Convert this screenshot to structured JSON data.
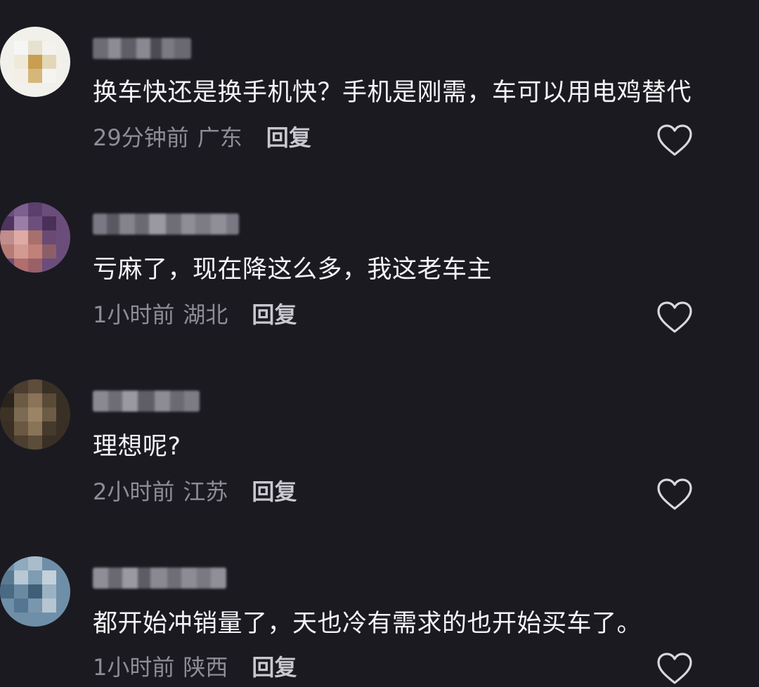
{
  "comments": [
    {
      "text": "换车快还是换手机快？手机是刚需，车可以用电鸡替代",
      "time": "29分钟前",
      "location": "广东",
      "reply_label": "回复",
      "avatar_colors": [
        "#f4f4f4",
        "#e0d9c7",
        "#c9a25a",
        "#f1efe8"
      ]
    },
    {
      "text": "亏麻了，现在降这么多，我这老车主",
      "time": "1小时前",
      "location": "湖北",
      "reply_label": "回复",
      "avatar_colors": [
        "#5a3c6e",
        "#8a6b9a",
        "#d9a7a2",
        "#b0706a"
      ]
    },
    {
      "text": "理想呢?",
      "time": "2小时前",
      "location": "江苏",
      "reply_label": "回复",
      "avatar_colors": [
        "#3b2e22",
        "#6d5a44",
        "#8a7458",
        "#2a241d"
      ]
    },
    {
      "text": "都开始冲销量了，天也冷有需求的也开始买车了。",
      "time": "1小时前",
      "location": "陕西",
      "reply_label": "回复",
      "avatar_colors": [
        "#6f8fa8",
        "#a9bccb",
        "#3f5f78",
        "#c4d0da"
      ]
    }
  ],
  "colors": {
    "background": "#1b1a21",
    "text": "#f4f4f6",
    "meta": "#8e8d96",
    "like_icon": "#d8d8dc"
  },
  "icons": {
    "like": "heart-outline-icon"
  }
}
